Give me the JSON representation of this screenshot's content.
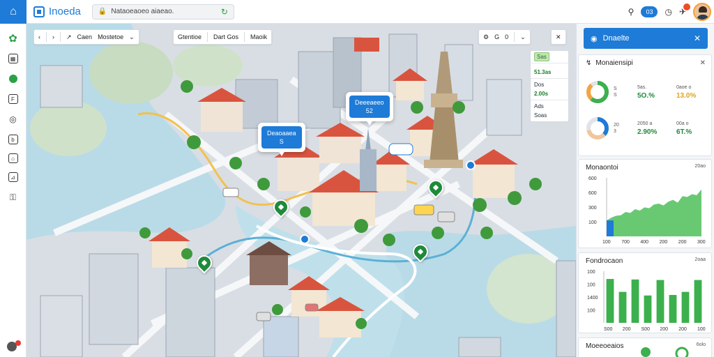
{
  "topbar": {
    "brand": "Inoeda",
    "url": "Nataoeaoeo aiaeao.",
    "pill": "03"
  },
  "map": {
    "nav": {
      "opt1": "Caen",
      "opt2": "Mostetoe"
    },
    "layers": {
      "a": "Gtentioe",
      "b": "Dart Gos",
      "c": "Maoik"
    },
    "tools": {
      "a": "G",
      "b": "G",
      "c": "0"
    },
    "legend": {
      "top": "Sas",
      "r1": "51.3as",
      "r2": "Dos",
      "r3": "2.00s",
      "r4": "Ads",
      "r5": "Soas"
    },
    "callout1": {
      "title": "Deeeaeeo",
      "value": "52"
    },
    "callout2": {
      "title": "Deaoaaea",
      "value": "S"
    }
  },
  "panel": {
    "header": "Dnaelte",
    "stats": {
      "title": "Monaiensipi",
      "row1": {
        "a": "S",
        "b": "S",
        "label1": "5as.",
        "label2": "0aoe o",
        "g": "5O.%",
        "o": "13.0%"
      },
      "row2": {
        "a": "20",
        "b": "3",
        "label1": "2050 a",
        "label2": "00a o",
        "g": "2.90%",
        "o": "6T.%"
      }
    },
    "line_chart": {
      "title": "Monaontoi",
      "badge": "20ao"
    },
    "bar_chart": {
      "title": "Fondrocaon",
      "badge": "2oaa"
    },
    "bottom": {
      "title": "Moeeoeaios",
      "badge": "6olo"
    }
  },
  "chart_data": [
    {
      "type": "area",
      "title": "Monaontoi",
      "y_ticks": [
        "100",
        "300",
        "600",
        "600"
      ],
      "x_ticks": [
        "100",
        "700",
        "400",
        "200",
        "200",
        "300"
      ],
      "values": [
        0.34,
        0.4,
        0.44,
        0.45,
        0.52,
        0.5,
        0.58,
        0.55,
        0.62,
        0.6,
        0.68,
        0.7,
        0.66,
        0.74,
        0.78,
        0.72,
        0.86,
        0.84,
        0.9,
        0.88,
        1.0
      ],
      "highlight": {
        "index": 0,
        "color": "#1e7bd7"
      }
    },
    {
      "type": "bar",
      "title": "Fondrocaon",
      "y_ticks": [
        "100",
        "1400",
        "100",
        "100"
      ],
      "x_ticks": [
        "S00",
        "200",
        "S00",
        "200",
        "200",
        "100"
      ],
      "values": [
        0.85,
        0.6,
        0.84,
        0.53,
        0.83,
        0.54,
        0.6,
        0.83
      ],
      "color": "#3cb04d"
    }
  ]
}
